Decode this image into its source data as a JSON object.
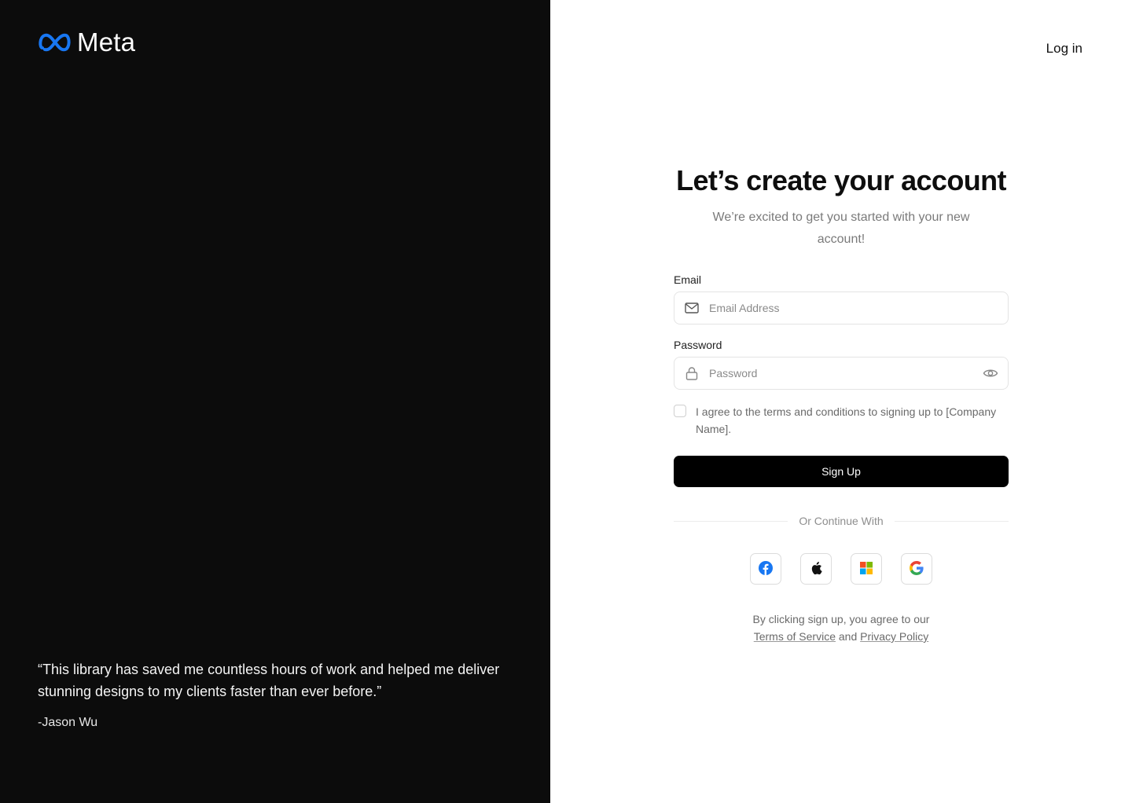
{
  "brand": {
    "name": "Meta",
    "logo_color": "#1877f2"
  },
  "testimonial": {
    "quote": "“This library has saved me countless hours of work and helped me deliver stunning designs to my clients faster than ever before.”",
    "author": "-Jason Wu"
  },
  "header": {
    "login_label": "Log in"
  },
  "form": {
    "title": "Let’s create your account",
    "subtitle": "We’re excited to get you started with your new account!",
    "email": {
      "label": "Email",
      "placeholder": "Email Address",
      "value": "",
      "icon": "mail-icon"
    },
    "password": {
      "label": "Password",
      "placeholder": "Password",
      "value": "",
      "icon": "lock-icon",
      "toggle_icon": "eye-icon"
    },
    "agree": {
      "checked": false,
      "text": "I agree to the terms and conditions to signing up to [Company Name]."
    },
    "submit_label": "Sign Up",
    "divider_text": "Or Continue With",
    "socials": [
      {
        "name": "facebook",
        "icon": "facebook-icon"
      },
      {
        "name": "apple",
        "icon": "apple-icon"
      },
      {
        "name": "microsoft",
        "icon": "microsoft-icon"
      },
      {
        "name": "google",
        "icon": "google-icon"
      }
    ],
    "legal": {
      "prefix": "By clicking sign up, you agree to our",
      "terms_label": "Terms of Service",
      "joiner": "and",
      "privacy_label": "Privacy Policy"
    }
  },
  "colors": {
    "left_panel_bg": "#0c0c0c",
    "primary_button_bg": "#000000",
    "facebook": "#1877f2",
    "microsoft": [
      "#f25022",
      "#7fba00",
      "#00a4ef",
      "#ffb900"
    ]
  }
}
